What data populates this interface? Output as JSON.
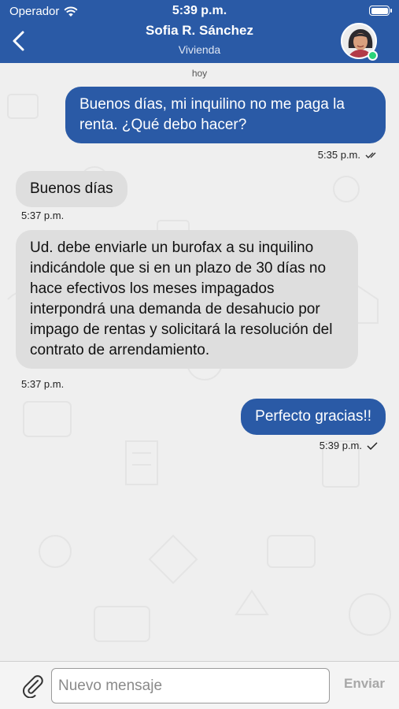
{
  "status_bar": {
    "carrier": "Operador",
    "time": "5:39 p.m."
  },
  "header": {
    "name": "Sofia R. Sánchez",
    "subtitle": "Vivienda",
    "back_icon": "chevron-left-icon",
    "online_color": "#2bd47a"
  },
  "chat": {
    "day_label": "hoy",
    "messages": [
      {
        "direction": "outgoing",
        "text": "Buenos días, mi inquilino no me paga la renta. ¿Qué debo hacer?",
        "time": "5:35 p.m.",
        "status": "double-check"
      },
      {
        "direction": "incoming",
        "text": "Buenos días",
        "time": "5:37 p.m."
      },
      {
        "direction": "incoming",
        "text": "Ud. debe enviarle un burofax a su inquilino indicándole que si en un plazo de 30 días no hace efectivos los meses impagados interpondrá una demanda de desahucio por impago de rentas y solicitará la resolución del contrato de arrendamiento.",
        "time": "5:37 p.m."
      },
      {
        "direction": "outgoing",
        "text": "Perfecto gracias!!",
        "time": "5:39 p.m.",
        "status": "single-check"
      }
    ]
  },
  "composer": {
    "placeholder": "Nuevo mensaje",
    "send_label": "Enviar",
    "attach_icon": "paperclip-icon"
  },
  "colors": {
    "brand": "#2a5aa6",
    "incoming_bubble": "#dedede",
    "background": "#efefef"
  }
}
